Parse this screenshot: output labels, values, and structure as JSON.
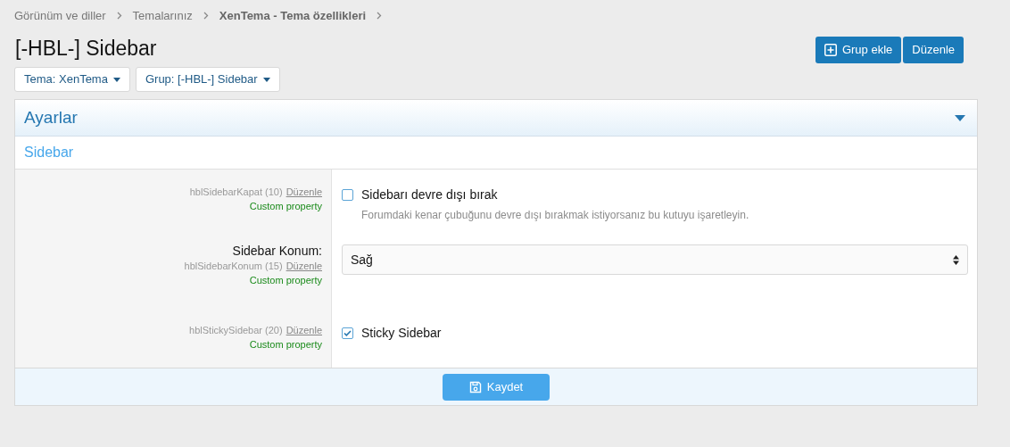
{
  "breadcrumbs": [
    {
      "label": "Görünüm ve diller",
      "current": false
    },
    {
      "label": "Temalarınız",
      "current": false
    },
    {
      "label": "XenTema - Tema özellikleri",
      "current": true
    }
  ],
  "title": "[-HBL-] Sidebar",
  "header_buttons": [
    {
      "label": "Grup ekle",
      "kind": "add"
    },
    {
      "label": "Düzenle",
      "kind": "plain"
    }
  ],
  "filters": [
    {
      "label": "Tema: XenTema"
    },
    {
      "label": "Grup: [-HBL-] Sidebar"
    }
  ],
  "panel": {
    "title": "Ayarlar",
    "section": "Sidebar",
    "rows": [
      {
        "kind": "checkbox",
        "property": "hblSidebarKapat (10)",
        "edit": "Düzenle",
        "note": "Custom property",
        "label": "Sidebarı devre dışı bırak",
        "checked": false,
        "hint": "Forumdaki kenar çubuğunu devre dışı bırakmak istiyorsanız bu kutuyu işaretleyin."
      },
      {
        "kind": "select",
        "title": "Sidebar Konum:",
        "property": "hblSidebarKonum (15)",
        "edit": "Düzenle",
        "note": "Custom property",
        "value": "Sağ"
      },
      {
        "kind": "checkbox",
        "property": "hblStickySidebar (20)",
        "edit": "Düzenle",
        "note": "Custom property",
        "label": "Sticky Sidebar",
        "checked": true
      }
    ],
    "save": "Kaydet"
  }
}
